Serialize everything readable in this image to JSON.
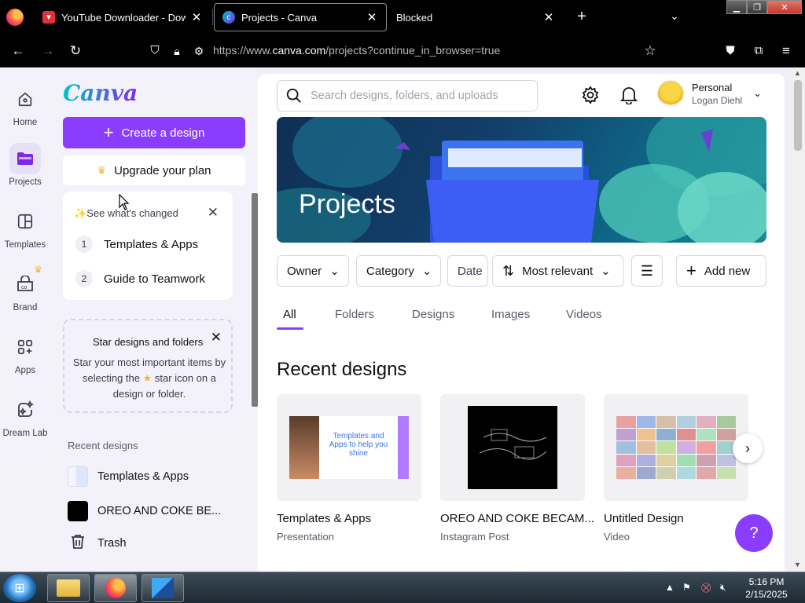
{
  "browser": {
    "tabs": [
      {
        "title": "YouTube Downloader - Downlo",
        "favicon": "download-icon",
        "color": "#e5303b"
      },
      {
        "title": "Projects - Canva",
        "favicon": "canva-icon",
        "color": "#7d2ae8",
        "active": true
      },
      {
        "title": "Blocked",
        "favicon": ""
      }
    ],
    "url_prefix": "https://www.",
    "url_domain": "canva.com",
    "url_path": "/projects?continue_in_browser=true"
  },
  "rail": {
    "items": [
      {
        "label": "Home",
        "icon": "home-icon"
      },
      {
        "label": "Projects",
        "icon": "folder-icon",
        "active": true
      },
      {
        "label": "Templates",
        "icon": "templates-icon"
      },
      {
        "label": "Brand",
        "icon": "brand-icon"
      },
      {
        "label": "Apps",
        "icon": "apps-icon"
      },
      {
        "label": "Dream Lab",
        "icon": "dream-lab-icon"
      }
    ]
  },
  "sidebar": {
    "logo": "Canva",
    "create_label": "Create a design",
    "upgrade_label": "Upgrade your plan",
    "changes": {
      "heading": "See what's changed",
      "items": [
        {
          "num": "1",
          "label": "Templates & Apps"
        },
        {
          "num": "2",
          "label": "Guide to Teamwork"
        }
      ]
    },
    "star_card": {
      "title": "Star designs and folders",
      "body_1": "Star your most important items by selecting the",
      "body_2": "star icon on a design or folder."
    },
    "recent_heading": "Recent designs",
    "recent": [
      {
        "label": "Templates & Apps"
      },
      {
        "label": "OREO AND COKE BE..."
      }
    ],
    "trash_label": "Trash"
  },
  "header": {
    "search_placeholder": "Search designs, folders, and uploads",
    "account_type": "Personal",
    "account_name": "Logan Diehl"
  },
  "hero": {
    "title": "Projects"
  },
  "filters": {
    "owner": "Owner",
    "category": "Category",
    "date": "Date",
    "sort": "Most relevant",
    "add_new": "Add new"
  },
  "tabs": [
    "All",
    "Folders",
    "Designs",
    "Images",
    "Videos"
  ],
  "recent_designs": {
    "title": "Recent designs",
    "items": [
      {
        "name": "Templates & Apps",
        "type": "Presentation",
        "thumb_text": "Templates and Apps to help you shine"
      },
      {
        "name": "OREO AND COKE BECAM...",
        "type": "Instagram Post"
      },
      {
        "name": "Untitled Design",
        "type": "Video"
      }
    ]
  },
  "help_label": "?",
  "taskbar": {
    "time": "5:16 PM",
    "date": "2/15/2025"
  },
  "colors": {
    "brand_purple": "#8b3dff",
    "page_bg": "#eef0f6"
  }
}
